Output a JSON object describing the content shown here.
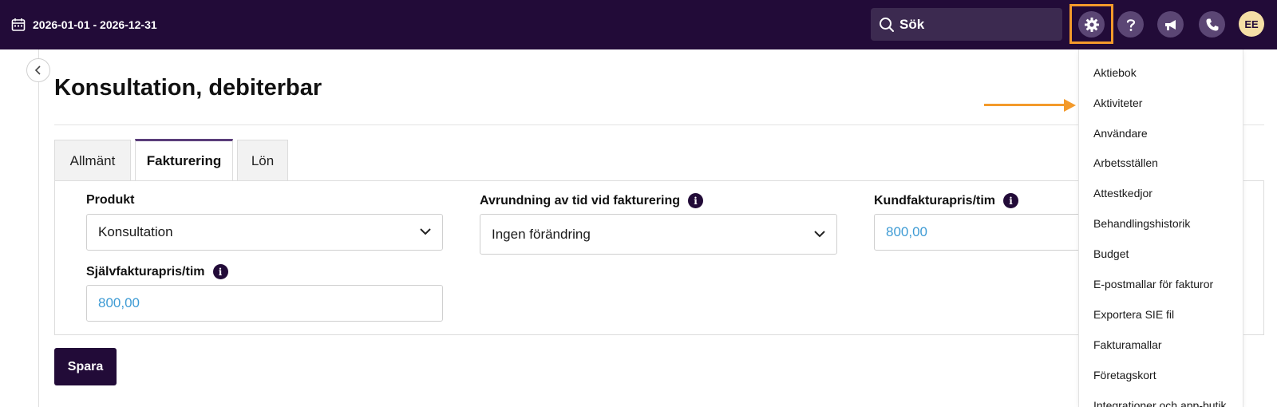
{
  "header": {
    "date_range": "2026-01-01 - 2026-12-31",
    "search_placeholder": "Sök",
    "avatar_initials": "EE"
  },
  "page": {
    "title": "Konsultation, debiterbar"
  },
  "tabs": [
    {
      "label": "Allmänt",
      "active": false
    },
    {
      "label": "Fakturering",
      "active": true
    },
    {
      "label": "Lön",
      "active": false
    }
  ],
  "form": {
    "product_label": "Produkt",
    "product_value": "Konsultation",
    "rounding_label": "Avrundning av tid vid fakturering",
    "rounding_value": "Ingen förändring",
    "customer_price_label": "Kundfakturapris/tim",
    "customer_price_value": "800,00",
    "self_price_label": "Självfakturapris/tim",
    "self_price_value": "800,00"
  },
  "actions": {
    "save_label": "Spara"
  },
  "settings_menu": {
    "items": [
      "Aktiebok",
      "Aktiviteter",
      "Användare",
      "Arbetsställen",
      "Attestkedjor",
      "Behandlingshistorik",
      "Budget",
      "E-postmallar för fakturor",
      "Exportera SIE fil",
      "Fakturamallar",
      "Företagskort",
      "Integrationer och app-butik"
    ],
    "highlighted_item": "Aktiviteter"
  },
  "colors": {
    "header_bg": "#220b38",
    "accent_orange": "#f39a2b",
    "value_blue": "#3e9bd4",
    "tab_active_border": "#5a3d7a"
  },
  "icons": [
    "calendar-icon",
    "search-icon",
    "gear-icon",
    "help-icon",
    "megaphone-icon",
    "phone-icon",
    "chevron-left-icon",
    "chevron-down-icon",
    "info-icon"
  ]
}
